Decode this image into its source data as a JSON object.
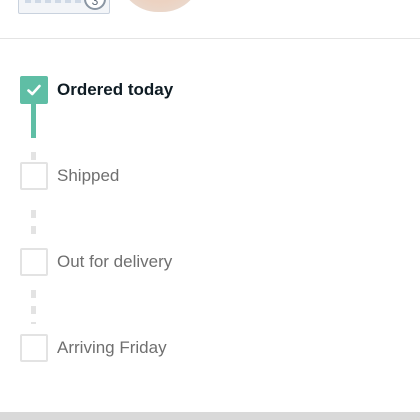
{
  "product_strip": {
    "quantity_badge": "3"
  },
  "tracking": {
    "steps": [
      {
        "label": "Ordered today",
        "status": "completed"
      },
      {
        "label": "Shipped",
        "status": "pending"
      },
      {
        "label": "Out for delivery",
        "status": "pending"
      },
      {
        "label": "Arriving Friday",
        "status": "pending"
      }
    ],
    "colors": {
      "completed": "#5fbea5",
      "pending_border": "#e3e3e3",
      "active_text": "#0f1c24",
      "pending_text": "#6f6f6f"
    }
  }
}
